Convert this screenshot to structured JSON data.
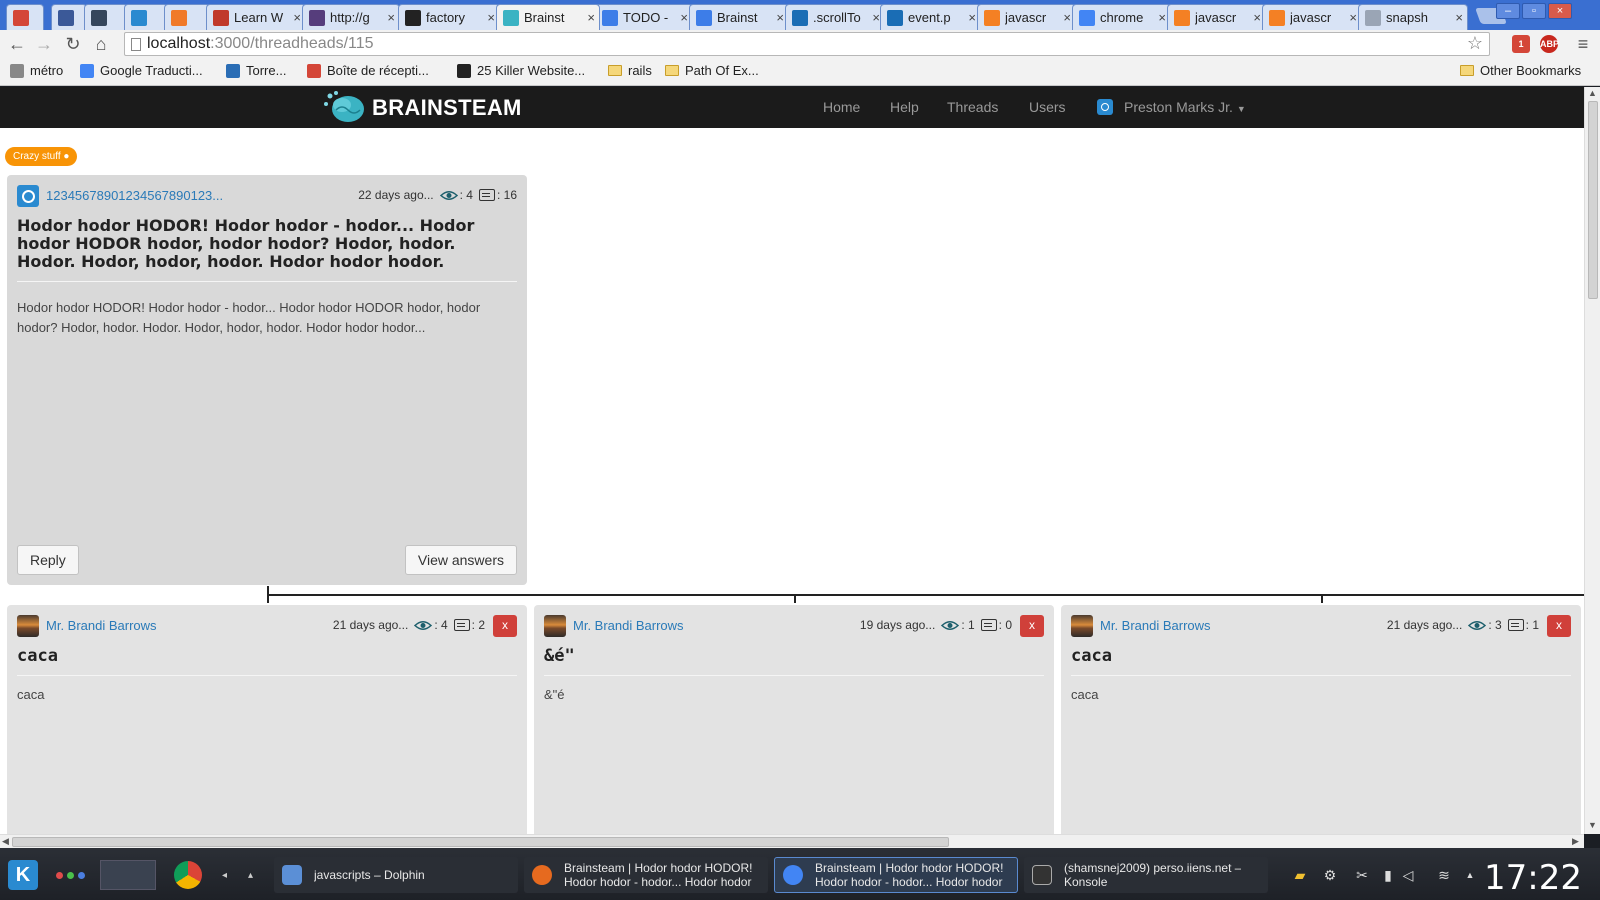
{
  "browser": {
    "tabs": [
      {
        "label": "",
        "icon": "gmail-icon",
        "color": "#d44638"
      },
      {
        "label": "",
        "icon": "facebook-icon",
        "color": "#3b5998"
      },
      {
        "label": "",
        "icon": "tumblr-icon",
        "color": "#35465c"
      },
      {
        "label": "",
        "icon": "d-app-icon",
        "color": "#2a8ad0"
      },
      {
        "label": "",
        "icon": "feed-icon",
        "color": "#f07a2a"
      },
      {
        "label": "Learn W",
        "icon": "learn-icon",
        "color": "#c0392b"
      },
      {
        "label": "http://g",
        "icon": "bootstrap-icon",
        "color": "#563d7c"
      },
      {
        "label": "factory",
        "icon": "github-icon",
        "color": "#222222"
      },
      {
        "label": "Brainst",
        "icon": "brainsteam-icon",
        "color": "#3bb3c3",
        "active": true
      },
      {
        "label": "TODO -",
        "icon": "docs-icon",
        "color": "#3d7de8"
      },
      {
        "label": "Brainst",
        "icon": "docs-icon",
        "color": "#3d7de8"
      },
      {
        "label": ".scrollTo",
        "icon": "jquery-icon",
        "color": "#1a6db5"
      },
      {
        "label": "event.p",
        "icon": "jquery-icon",
        "color": "#1a6db5"
      },
      {
        "label": "javascr",
        "icon": "stackoverflow-icon",
        "color": "#f48024"
      },
      {
        "label": "chrome",
        "icon": "google-icon",
        "color": "#4285f4"
      },
      {
        "label": "javascr",
        "icon": "stackoverflow-icon",
        "color": "#f48024"
      },
      {
        "label": "javascr",
        "icon": "stackoverflow-icon",
        "color": "#f48024"
      },
      {
        "label": "snapsh",
        "icon": "page-icon",
        "color": "#9aa5b5"
      }
    ],
    "tab_close": "×",
    "window_buttons": [
      "–",
      "▫",
      "×"
    ],
    "url_host": "localhost",
    "url_rest": ":3000/threadheads/115",
    "gmail_badge": "1",
    "abp_label": "ABP",
    "bookmarks": [
      {
        "label": "métro",
        "icon": "page-icon"
      },
      {
        "label": "Google Traducti...",
        "icon": "translate-icon"
      },
      {
        "label": "Torre...",
        "icon": "torrent-icon"
      },
      {
        "label": "Boîte de récepti...",
        "icon": "gmail-icon"
      },
      {
        "label": "25 Killer Website...",
        "icon": "website-icon"
      },
      {
        "label": "rails",
        "icon": "folder-icon"
      },
      {
        "label": "Path Of Ex...",
        "icon": "folder-icon"
      }
    ],
    "other_bookmarks": "Other Bookmarks"
  },
  "app": {
    "brand": "BRAINSTEAM",
    "nav": [
      "Home",
      "Help",
      "Threads",
      "Users"
    ],
    "user": "Preston Marks Jr.",
    "badge": "Crazy stuff ●",
    "thread": {
      "author": "12345678901234567890123...",
      "time": "22 days ago...",
      "views": ": 4",
      "answers": ": 16",
      "title": "Hodor hodor HODOR! Hodor hodor - hodor... Hodor hodor HODOR hodor, hodor hodor? Hodor, hodor. Hodor. Hodor, hodor, hodor. Hodor hodor hodor.",
      "body": "Hodor hodor HODOR! Hodor hodor - hodor... Hodor hodor HODOR hodor, hodor hodor? Hodor, hodor. Hodor. Hodor, hodor, hodor. Hodor hodor hodor...",
      "reply_label": "Reply",
      "answers_label": "View answers"
    },
    "replies": [
      {
        "author": "Mr. Brandi Barrows",
        "time": "21 days ago...",
        "views": ": 4",
        "answers": ": 2",
        "title": "caca",
        "body": "caca",
        "delete": "x"
      },
      {
        "author": "Mr. Brandi Barrows",
        "time": "19 days ago...",
        "views": ": 1",
        "answers": ": 0",
        "title": "&é\"",
        "body": "&\"é",
        "delete": "x"
      },
      {
        "author": "Mr. Brandi Barrows",
        "time": "21 days ago...",
        "views": ": 3",
        "answers": ": 1",
        "title": "caca",
        "body": "caca",
        "delete": "x"
      }
    ]
  },
  "taskbar": {
    "tasks": [
      {
        "label": "javascripts – Dolphin",
        "icon": "dolphin-icon"
      },
      {
        "label": "Brainsteam | Hodor hodor HODOR!\nHodor hodor - hodor... Hodor hodor",
        "icon": "firefox-icon"
      },
      {
        "label": "Brainsteam | Hodor hodor HODOR!\nHodor hodor - hodor... Hodor hodor",
        "icon": "chrome-icon",
        "active": true
      },
      {
        "label": "(shamsnej2009) perso.iiens.net –\nKonsole",
        "icon": "konsole-icon"
      }
    ],
    "clock": "17:22"
  }
}
